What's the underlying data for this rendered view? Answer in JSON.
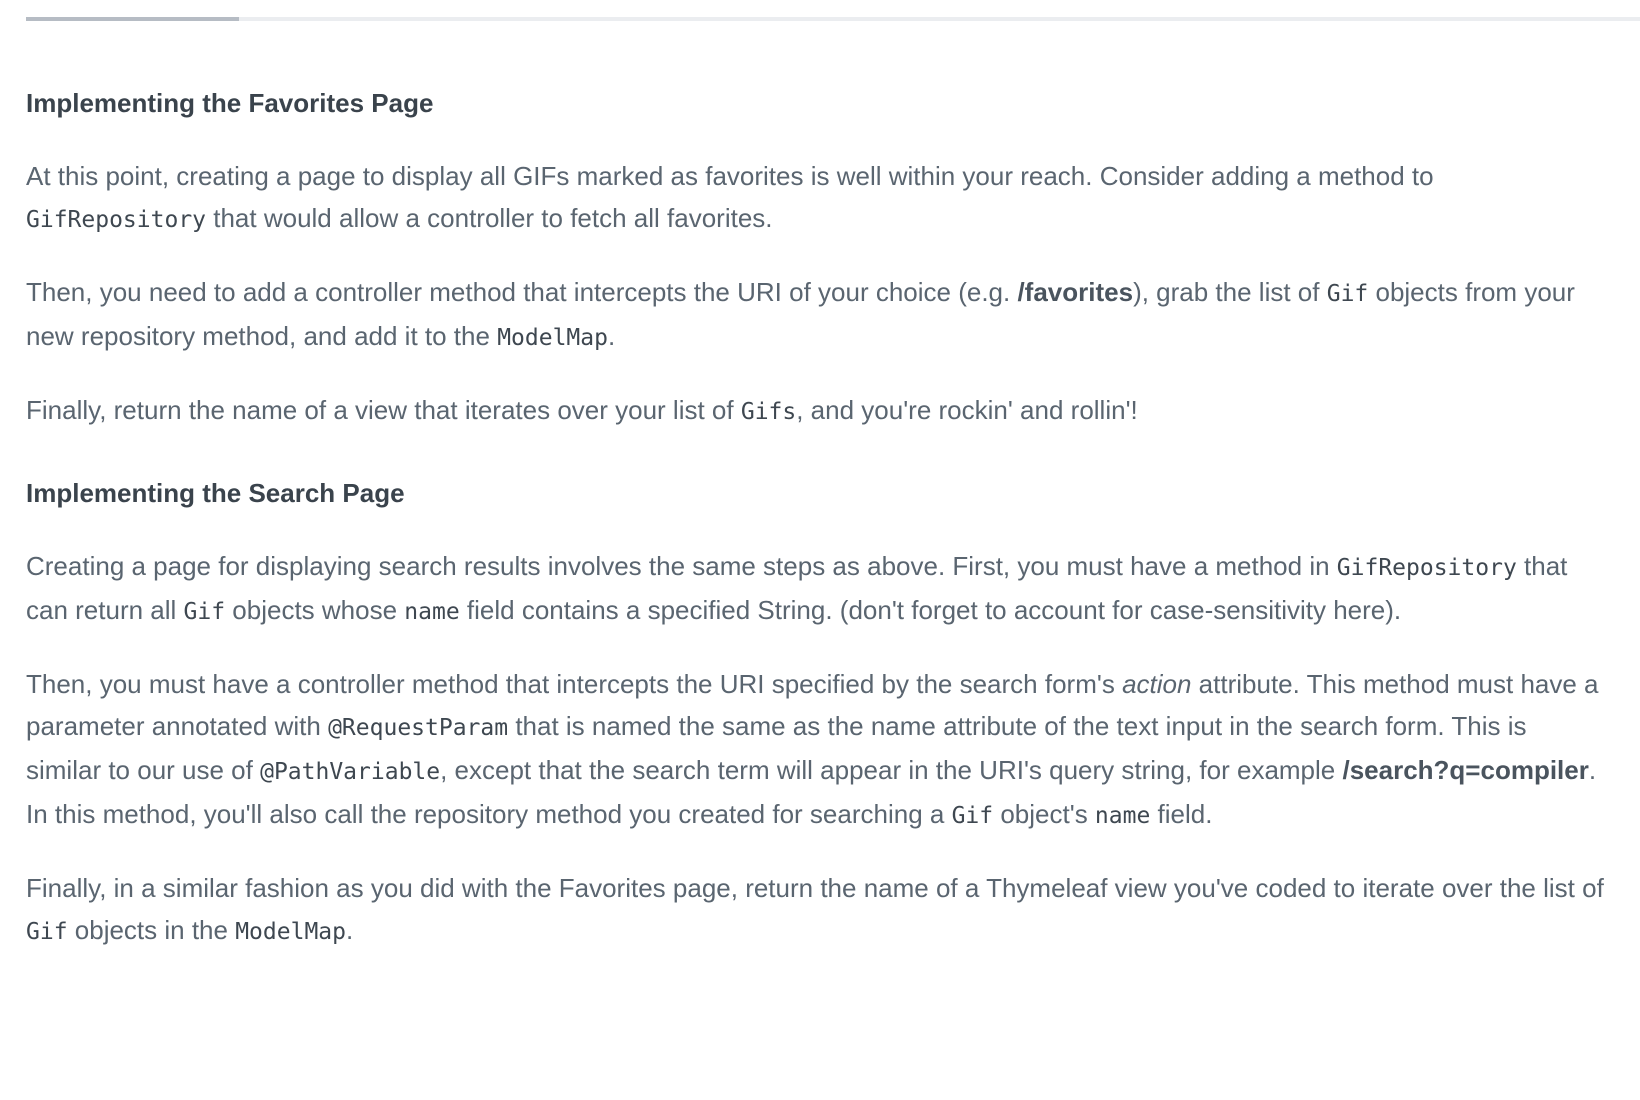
{
  "progress": {
    "fraction": 0.132
  },
  "sections": [
    {
      "heading": "Implementing the Favorites Page",
      "p1": {
        "t1": "At this point, creating a page to display all GIFs marked as favorites is well within your reach. Consider adding a method to ",
        "c1": "GifRepository",
        "t2": " that would allow a controller to fetch all favorites."
      },
      "p2": {
        "t1": "Then, you need to add a controller method that intercepts the URI of your choice (e.g. ",
        "b1": "/favorites",
        "t2": "), grab the list of ",
        "c1": "Gif",
        "t3": " objects from your new repository method, and add it to the ",
        "c2": "ModelMap",
        "t4": "."
      },
      "p3": {
        "t1": "Finally, return the name of a view that iterates over your list of ",
        "c1": "Gifs",
        "t2": ", and you're rockin' and rollin'!"
      }
    },
    {
      "heading": "Implementing the Search Page",
      "p1": {
        "t1": "Creating a page for displaying search results involves the same steps as above. First, you must have a method in ",
        "c1": "GifRepository",
        "t2": " that can return all ",
        "c2": "Gif",
        "t3": " objects whose ",
        "c3": "name",
        "t4": " field contains a specified String. (don't forget to account for case-sensitivity here)."
      },
      "p2": {
        "t1": "Then, you must have a controller method that intercepts the URI specified by the search form's ",
        "e1": "action",
        "t2": " attribute. This method must have a parameter annotated with ",
        "c1": "@RequestParam",
        "t3": " that is named the same as the name attribute of the text input in the search form. This is similar to our use of ",
        "c2": "@PathVariable",
        "t4": ", except that the search term will appear in the URI's query string, for example ",
        "b1": "/search?q=compiler",
        "t5": ". In this method, you'll also call the repository method you created for searching a ",
        "c3": "Gif",
        "t6": " object's ",
        "c4": "name",
        "t7": " field."
      },
      "p3": {
        "t1": "Finally, in a similar fashion as you did with the Favorites page, return the name of a Thymeleaf view you've coded to iterate over the list of ",
        "c1": "Gif",
        "t2": " objects in the ",
        "c2": "ModelMap",
        "t3": "."
      }
    }
  ]
}
